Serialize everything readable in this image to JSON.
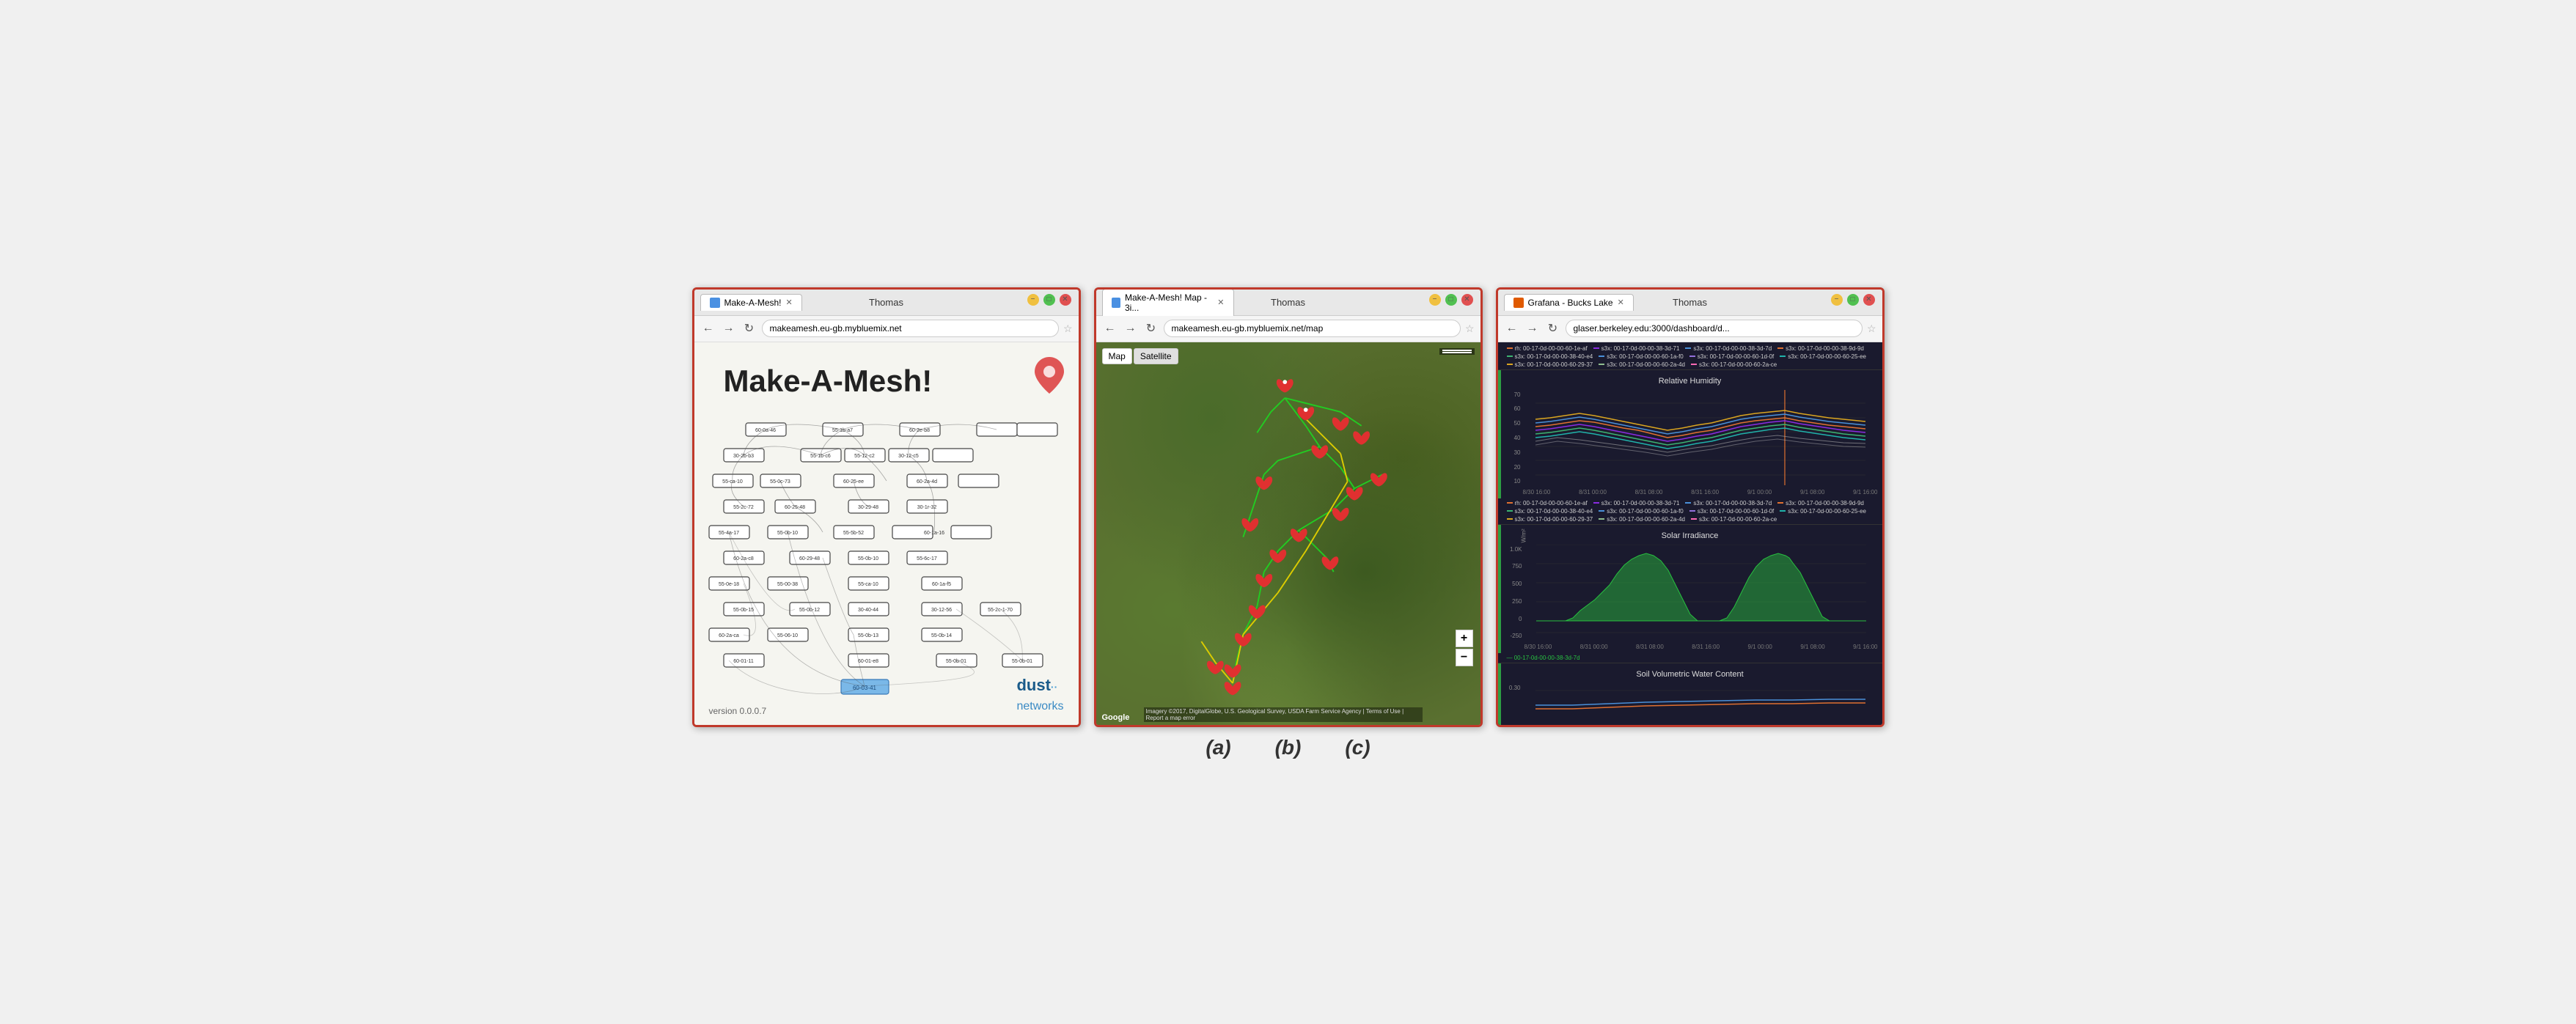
{
  "windows": {
    "a": {
      "tab_title": "Make-A-Mesh!",
      "user": "Thomas",
      "url": "makeamesh.eu-gb.mybluemix.net",
      "title": "Make-A-Mesh!",
      "version": "version 0.0.0.7",
      "logo": "dust",
      "logo_sub": "networks",
      "label": "(a)"
    },
    "b": {
      "tab_title": "Make-A-Mesh! Map - 3i...",
      "user": "Thomas",
      "url": "makeamesh.eu-gb.mybluemix.net/map",
      "map_btn_1": "Map",
      "map_btn_2": "Satellite",
      "zoom_in": "+",
      "zoom_out": "−",
      "google": "Google",
      "copyright": "Imagery ©2017, DigitalGlobe, U.S. Geological Survey, USDA Farm Service Agency | Terms of Use | Report a map error",
      "label": "(b)"
    },
    "c": {
      "tab_title": "Grafana - Bucks Lake",
      "user": "Thomas",
      "url": "glaser.berkeley.edu:3000/dashboard/d...",
      "chart1_title": "Relative Humidity",
      "chart2_title": "Solar Irradiance",
      "chart3_title": "Soil Volumetric Water Content",
      "chart1_y_labels": [
        "70",
        "60",
        "50",
        "40",
        "30",
        "20",
        "10"
      ],
      "chart2_y_labels": [
        "1.0K",
        "750",
        "500",
        "250",
        "0",
        "-250"
      ],
      "chart_x_labels": [
        "8/30 16:00",
        "8/31 00:00",
        "8/31 08:00",
        "8/31 16:00",
        "9/1 00:00",
        "9/1 08:00",
        "9/1 16:00"
      ],
      "y_unit_1": "%",
      "y_unit_2": "W/m²",
      "legend_items": [
        {
          "color": "#e07030",
          "label": "rh: 00-17-0d-00-00-60-1e-af"
        },
        {
          "color": "#8a2be2",
          "label": "s3x: 00-17-0d-00-00-38-3d-71"
        },
        {
          "color": "#4a90d9",
          "label": "s3x: 00-17-0d-00-00-38-3d-7d"
        },
        {
          "color": "#e07030",
          "label": "s3x: 00-17-0d-00-00-38-9d-9d"
        },
        {
          "color": "#3cb371",
          "label": "s3x: 00-17-0d-00-00-38-40-e4"
        },
        {
          "color": "#4a90d9",
          "label": "s3x: 00-17-0d-00-00-60-1a-f0"
        },
        {
          "color": "#9370db",
          "label": "s3x: 00-17-0d-00-00-60-1d-0f"
        },
        {
          "color": "#20b2aa",
          "label": "s3x: 00-17-0d-00-00-60-25-ee"
        },
        {
          "color": "#daa520",
          "label": "s3x: 00-17-0d-00-00-60-29-37"
        },
        {
          "color": "#8fbc8f",
          "label": "s3x: 00-17-0d-00-00-60-2a-4d"
        },
        {
          "color": "#ff69b4",
          "label": "s3x: 00-17-0d-00-00-60-2a-ce"
        }
      ],
      "solar_legend": "— 00-17-0d-00-00-38-3d-7d",
      "label": "(c)"
    }
  }
}
